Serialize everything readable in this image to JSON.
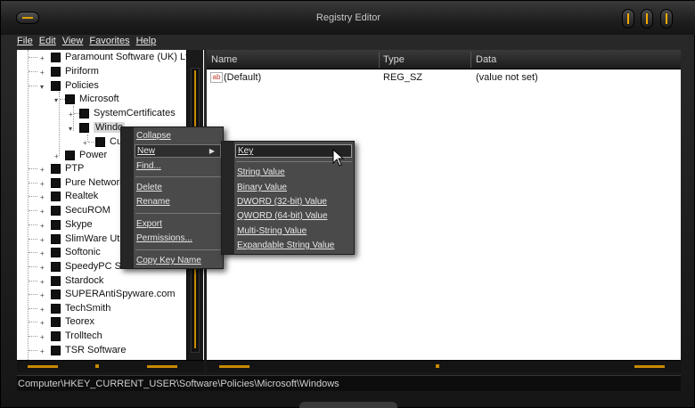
{
  "window": {
    "title": "Registry Editor"
  },
  "menu": [
    "File",
    "Edit",
    "View",
    "Favorites",
    "Help"
  ],
  "tree": {
    "items": [
      {
        "label": "Paramount Software (UK) Ltd.",
        "depth": 0,
        "expander": "+"
      },
      {
        "label": "Piriform",
        "depth": 0,
        "expander": "+"
      },
      {
        "label": "Policies",
        "depth": 0,
        "expander": "-"
      },
      {
        "label": "Microsoft",
        "depth": 1,
        "expander": "-"
      },
      {
        "label": "SystemCertificates",
        "depth": 2,
        "expander": "+"
      },
      {
        "label": "Windo",
        "depth": 2,
        "expander": "-"
      },
      {
        "label": "Cu",
        "depth": 3,
        "expander": "+"
      },
      {
        "label": "Power",
        "depth": 1,
        "expander": "+"
      },
      {
        "label": "PTP",
        "depth": 0,
        "expander": "+"
      },
      {
        "label": "Pure Network",
        "depth": 0,
        "expander": "+"
      },
      {
        "label": "Realtek",
        "depth": 0,
        "expander": "+"
      },
      {
        "label": "SecuROM",
        "depth": 0,
        "expander": "+"
      },
      {
        "label": "Skype",
        "depth": 0,
        "expander": "+"
      },
      {
        "label": "SlimWare Util",
        "depth": 0,
        "expander": "+"
      },
      {
        "label": "Softonic",
        "depth": 0,
        "expander": "+"
      },
      {
        "label": "SpeedyPC So",
        "depth": 0,
        "expander": "+"
      },
      {
        "label": "Stardock",
        "depth": 0,
        "expander": "+"
      },
      {
        "label": "SUPERAntiSpyware.com",
        "depth": 0,
        "expander": "+"
      },
      {
        "label": "TechSmith",
        "depth": 0,
        "expander": "+"
      },
      {
        "label": "Teorex",
        "depth": 0,
        "expander": "+"
      },
      {
        "label": "Trolltech",
        "depth": 0,
        "expander": "+"
      },
      {
        "label": "TSR Software",
        "depth": 0,
        "expander": "+"
      }
    ]
  },
  "list": {
    "columns": [
      "Name",
      "Type",
      "Data"
    ],
    "rows": [
      {
        "icon": "ab",
        "name": "(Default)",
        "type": "REG_SZ",
        "data": "(value not set)"
      }
    ]
  },
  "context_menu": {
    "items": [
      "Collapse",
      "New",
      "Find...",
      "Delete",
      "Rename",
      "Export",
      "Permissions...",
      "Copy Key Name"
    ]
  },
  "submenu": {
    "items": [
      "Key",
      "String Value",
      "Binary Value",
      "DWORD (32-bit) Value",
      "QWORD (64-bit) Value",
      "Multi-String Value",
      "Expandable String Value"
    ]
  },
  "status": {
    "path": "Computer\\HKEY_CURRENT_USER\\Software\\Policies\\Microsoft\\Windows"
  },
  "colors": {
    "accent": "#c88a00",
    "chrome": "#1e1e1e",
    "menu_bg": "#4a4a4a"
  }
}
